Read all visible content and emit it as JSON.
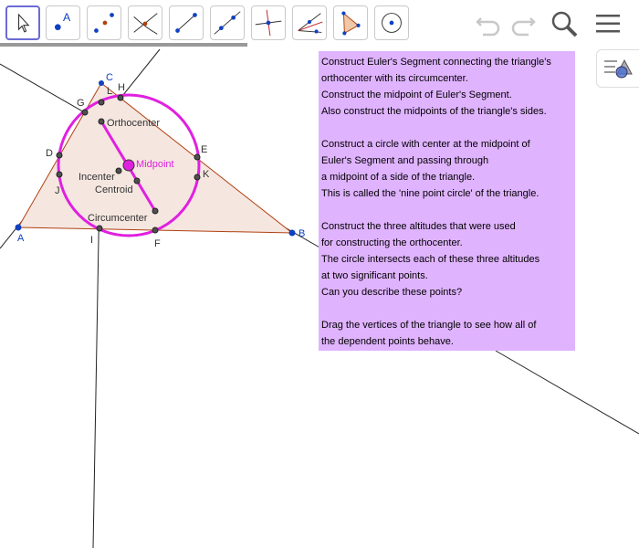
{
  "toolbar": {
    "tools": [
      {
        "name": "move-tool",
        "label": ""
      },
      {
        "name": "point-tool",
        "label": "A"
      }
    ]
  },
  "colors": {
    "triangle_fill": "#f5e6e0",
    "triangle_edge": "#b04010",
    "circle": "#e020e0",
    "euler_segment": "#e020e0",
    "note_bg": "#e0b3ff",
    "vertex_point": "#1040c0",
    "dependent_point": "#404040",
    "midpoint_label": "#e020e0"
  },
  "points": {
    "A": "A",
    "B": "B",
    "C": "C",
    "D": "D",
    "E": "E",
    "F": "F",
    "G": "G",
    "H": "H",
    "I": "I",
    "J": "J",
    "K": "K",
    "L": "L"
  },
  "labels": {
    "orthocenter": "Orthocenter",
    "incenter": "Incenter",
    "centroid": "Centroid",
    "circumcenter": "Circumcenter",
    "midpoint": "Midpoint"
  },
  "note": {
    "lines": [
      "Construct Euler's Segment connecting the triangle's",
      "orthocenter with its circumcenter.",
      "Construct the midpoint of Euler's Segment.",
      "Also construct the midpoints of the triangle's sides.",
      "",
      "Construct a circle with center at the midpoint of",
      "Euler's Segment and passing through",
      "a midpoint of a side of the triangle.",
      "This is called the 'nine point circle' of the triangle.",
      "",
      "Construct the three altitudes that were used",
      "for constructing the orthocenter.",
      "The circle intersects each of these three altitudes",
      "at two significant points.",
      "Can you describe these points?",
      "",
      "Drag the vertices of the triangle to see how all of",
      "the dependent points behave."
    ]
  }
}
